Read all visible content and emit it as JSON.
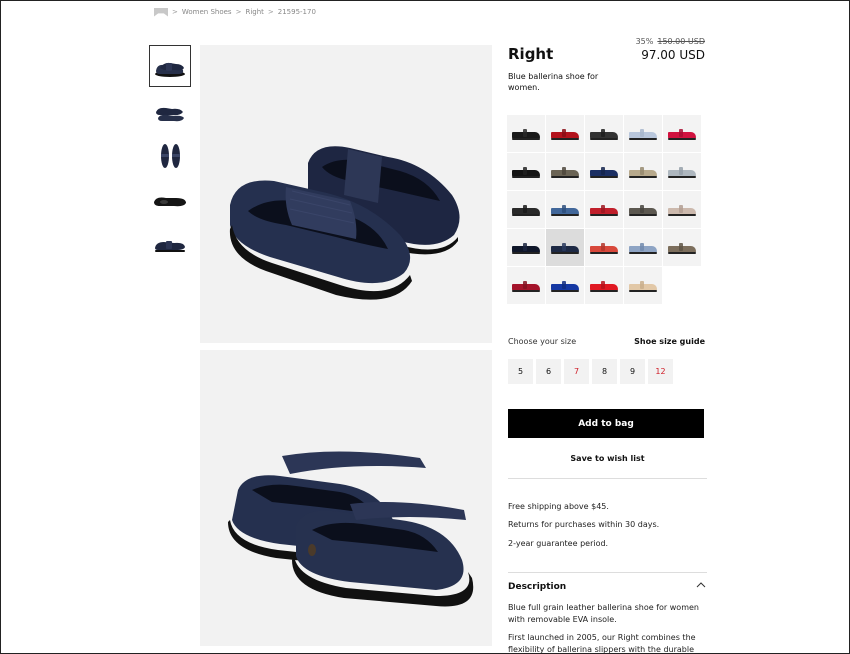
{
  "breadcrumb": {
    "items": [
      "Women Shoes",
      "Right",
      "21595-170"
    ],
    "separator": ">"
  },
  "thumbnails": [
    {
      "name": "thumb-pair-side",
      "active": true
    },
    {
      "name": "thumb-pair-top",
      "active": false
    },
    {
      "name": "thumb-pair-above",
      "active": false
    },
    {
      "name": "thumb-sole",
      "active": false
    },
    {
      "name": "thumb-single-side",
      "active": false
    }
  ],
  "product": {
    "title": "Right",
    "subtitle": "Blue ballerina shoe for women.",
    "discount": "35%",
    "old_price": "150.00 USD",
    "price": "97.00 USD"
  },
  "colors": [
    {
      "body": "#1a1a1a",
      "strap": "#2a2a2a"
    },
    {
      "body": "#b3121c",
      "strap": "#8a0e16"
    },
    {
      "body": "#333333",
      "strap": "#1e1e1e"
    },
    {
      "body": "#b9c7dc",
      "strap": "#a7b6cc"
    },
    {
      "body": "#d1123f",
      "strap": "#a80d33"
    },
    {
      "body": "#151515",
      "strap": "#222222"
    },
    {
      "body": "#6b6455",
      "strap": "#4d473c"
    },
    {
      "body": "#1b2f63",
      "strap": "#14244c"
    },
    {
      "body": "#b7a98c",
      "strap": "#978a6f"
    },
    {
      "body": "#aeb7bf",
      "strap": "#95a0a9"
    },
    {
      "body": "#2a2a2a",
      "strap": "#1a1a1a"
    },
    {
      "body": "#41679a",
      "strap": "#2e4f7c"
    },
    {
      "body": "#c11f2b",
      "strap": "#9c1721"
    },
    {
      "body": "#5c5850",
      "strap": "#47443e"
    },
    {
      "body": "#ccb9ad",
      "strap": "#b19e92"
    },
    {
      "body": "#0f1629",
      "strap": "#1b2440"
    },
    {
      "body": "#1d2944",
      "strap": "#2a3a5e"
    },
    {
      "body": "#d8483b",
      "strap": "#b3362b"
    },
    {
      "body": "#8ea4c4",
      "strap": "#7189ad"
    },
    {
      "body": "#7c6e5c",
      "strap": "#5e5344"
    },
    {
      "body": "#a4132a",
      "strap": "#82101f"
    },
    {
      "body": "#1538a3",
      "strap": "#0f2b80"
    },
    {
      "body": "#e01822",
      "strap": "#b5121b"
    },
    {
      "body": "#e2c8a7",
      "strap": "#c9ae8b"
    }
  ],
  "selected_color_index": 16,
  "size": {
    "label": "Choose your size",
    "guide": "Shoe size guide",
    "options": [
      {
        "label": "5",
        "available": true
      },
      {
        "label": "6",
        "available": true
      },
      {
        "label": "7",
        "available": false
      },
      {
        "label": "8",
        "available": true
      },
      {
        "label": "9",
        "available": true
      },
      {
        "label": "12",
        "available": false
      }
    ]
  },
  "actions": {
    "add_to_bag": "Add to bag",
    "wish_list": "Save to wish list"
  },
  "info": {
    "shipping": "Free shipping above $45.",
    "returns": "Returns for purchases within 30 days.",
    "guarantee": "2-year guarantee period."
  },
  "description": {
    "heading": "Description",
    "paragraph1": "Blue full grain leather ballerina shoe for women with removable EVA insole.",
    "paragraph2": "First launched in 2005, our Right combines the flexibility of ballerina slippers with the durable"
  },
  "colors_theme": {
    "unavailable": "#d0202a",
    "button_bg": "#000000",
    "image_bg": "#f2f2f2"
  }
}
